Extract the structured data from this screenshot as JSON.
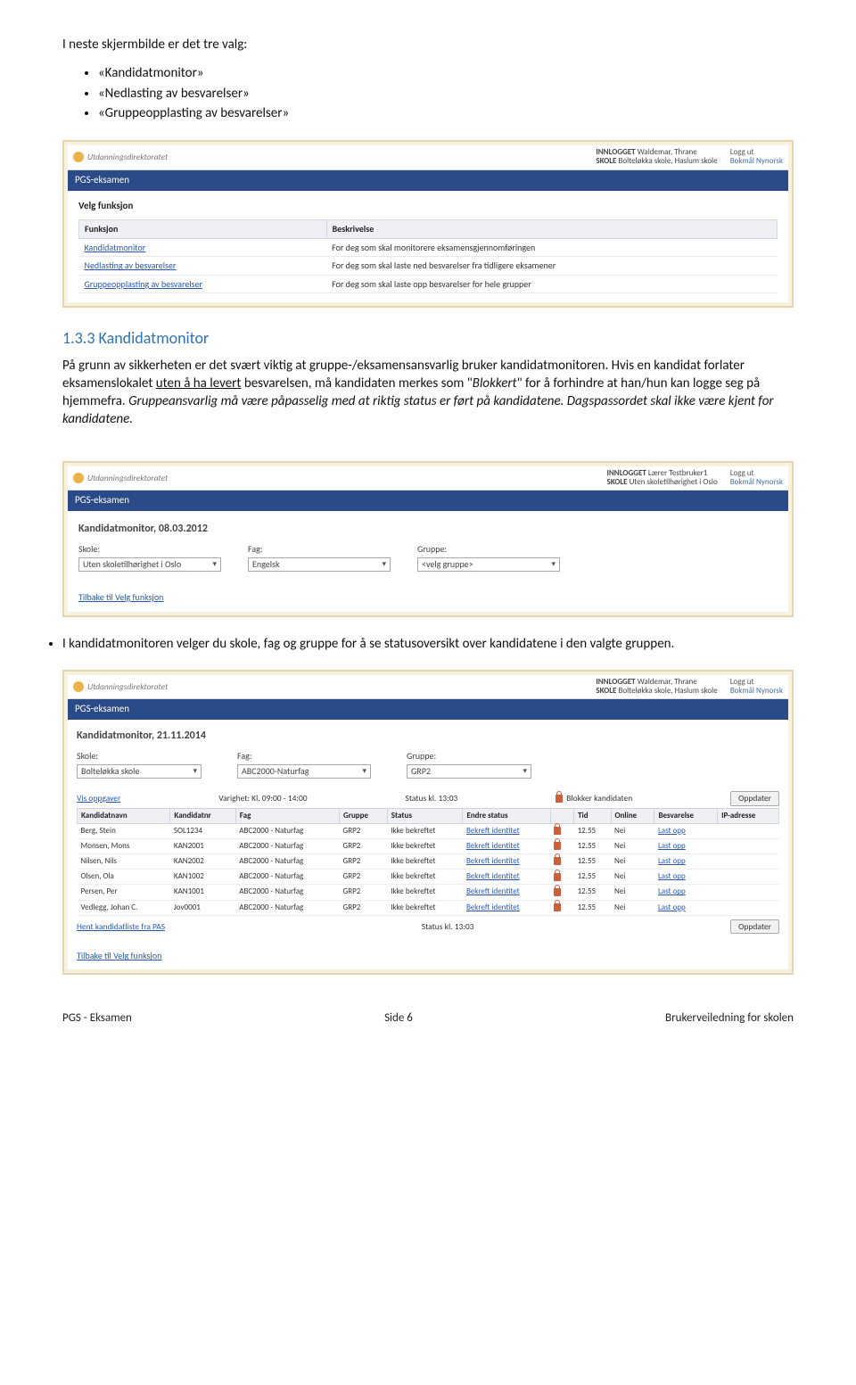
{
  "intro": "I neste skjermbilde er det tre valg:",
  "intro_items": [
    "«Kandidatmonitor»",
    "«Nedlasting av besvarelser»",
    "«Gruppeopplasting av besvarelser»"
  ],
  "ss1": {
    "brand": "Utdanningsdirektoratet",
    "login_label": "INNLOGGET",
    "login_user": "Waldemar, Thrane",
    "skole_label": "SKOLE",
    "skole_value": "Bolteløkka skole, Haslum skole",
    "logout": "Logg ut",
    "lang1": "Bokmål",
    "lang2": "Nynorsk",
    "bar": "PGS-eksamen",
    "heading": "Velg funksjon",
    "th1": "Funksjon",
    "th2": "Beskrivelse",
    "rows": [
      {
        "f": "Kandidatmonitor",
        "b": "For deg som skal monitorere eksamensgjennomføringen"
      },
      {
        "f": "Nedlasting av besvarelser",
        "b": "For deg som skal laste ned besvarelser fra tidligere eksamener"
      },
      {
        "f": "Gruppeopplasting av besvarelser",
        "b": "For deg som skal laste opp besvarelser for hele grupper"
      }
    ]
  },
  "section_num": "1.3.3",
  "section_title": "Kandidatmonitor",
  "para": "På grunn av sikkerheten er det svært viktig at gruppe-/eksamensansvarlig bruker kandidatmonitoren. Hvis en kandidat forlater eksamenslokalet uten å ha levert besvarelsen, må kandidaten merkes som \"Blokkert\" for å forhindre at han/hun kan logge seg på hjemmefra. Gruppeansvarlig må være påpasselig med at riktig status er ført på kandidatene. Dagspassordet skal ikke være kjent for kandidatene.",
  "para_underline": "uten å ha levert",
  "ss2": {
    "login_user": "Lærer Testbruker1",
    "skole_value": "Uten skoletilhørighet i Oslo",
    "title": "Kandidatmonitor, 08.03.2012",
    "skole_label": "Skole:",
    "fag_label": "Fag:",
    "gruppe_label": "Gruppe:",
    "sel_skole": "Uten skoletilhørighet i Oslo",
    "sel_fag": "Engelsk",
    "sel_gruppe": "<velg gruppe>",
    "back": "Tilbake til Velg funksjon"
  },
  "note": "I kandidatmonitoren velger du skole, fag og gruppe for å se statusoversikt over kandidatene i den valgte gruppen.",
  "ss3": {
    "login_user": "Waldemar, Thrane",
    "skole_value": "Bolteløkka skole, Haslum skole",
    "title": "Kandidatmonitor, 21.11.2014",
    "skole_label": "Skole:",
    "fag_label": "Fag:",
    "gruppe_label": "Gruppe:",
    "sel_skole": "Bolteløkka skole",
    "sel_fag": "ABC2000-Naturfag",
    "sel_gruppe": "GRP2",
    "vis": "Vis oppgaver",
    "varighet": "Varighet: Kl. 09:00 - 14:00",
    "status": "Status kl. 13:03",
    "blokker": "Blokker kandidaten",
    "oppdater": "Oppdater",
    "headers": [
      "Kandidatnavn",
      "Kandidatnr",
      "Fag",
      "Gruppe",
      "Status",
      "Endre status",
      "",
      "Tid",
      "Online",
      "Besvarelse",
      "IP-adresse"
    ],
    "rows": [
      {
        "n": "Berg, Stein",
        "nr": "SOL1234",
        "f": "ABC2000 - Naturfag",
        "g": "GRP2",
        "s": "Ikke bekreftet",
        "e": "Bekreft identitet",
        "t": "12.55",
        "o": "Nei",
        "b": "Last opp"
      },
      {
        "n": "Monsen, Mons",
        "nr": "KAN2001",
        "f": "ABC2000 - Naturfag",
        "g": "GRP2",
        "s": "Ikke bekreftet",
        "e": "Bekreft identitet",
        "t": "12.55",
        "o": "Nei",
        "b": "Last opp"
      },
      {
        "n": "Nilsen, Nils",
        "nr": "KAN2002",
        "f": "ABC2000 - Naturfag",
        "g": "GRP2",
        "s": "Ikke bekreftet",
        "e": "Bekreft identitet",
        "t": "12.55",
        "o": "Nei",
        "b": "Last opp"
      },
      {
        "n": "Olsen, Ola",
        "nr": "KAN1002",
        "f": "ABC2000 - Naturfag",
        "g": "GRP2",
        "s": "Ikke bekreftet",
        "e": "Bekreft identitet",
        "t": "12.55",
        "o": "Nei",
        "b": "Last opp"
      },
      {
        "n": "Persen, Per",
        "nr": "KAN1001",
        "f": "ABC2000 - Naturfag",
        "g": "GRP2",
        "s": "Ikke bekreftet",
        "e": "Bekreft identitet",
        "t": "12.55",
        "o": "Nei",
        "b": "Last opp"
      },
      {
        "n": "Vedlegg, Johan C.",
        "nr": "Jov0001",
        "f": "ABC2000 - Naturfag",
        "g": "GRP2",
        "s": "Ikke bekreftet",
        "e": "Bekreft identitet",
        "t": "12.55",
        "o": "Nei",
        "b": "Last opp"
      }
    ],
    "hent": "Hent kandidatliste fra PAS",
    "status2": "Status kl. 13:03",
    "back": "Tilbake til Velg funksjon"
  },
  "footer": {
    "left": "PGS - Eksamen",
    "center": "Side 6",
    "right": "Brukerveiledning for skolen"
  }
}
